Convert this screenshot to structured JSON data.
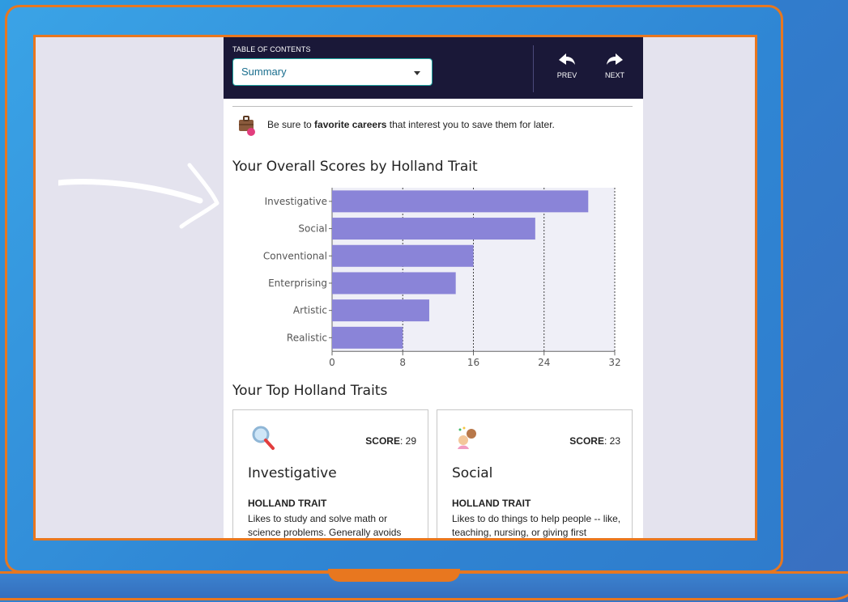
{
  "toc": {
    "label": "TABLE OF CONTENTS",
    "selected": "Summary"
  },
  "nav": {
    "prev_label": "PREV",
    "next_label": "NEXT"
  },
  "tip": {
    "prefix": "Be sure to ",
    "bold": "favorite careers",
    "suffix": " that interest you to save them for later."
  },
  "sections": {
    "overall_heading": "Your Overall Scores by Holland Trait",
    "top_heading": "Your Top Holland Traits"
  },
  "chart_data": {
    "type": "bar",
    "orientation": "horizontal",
    "title": "Your Overall Scores by Holland Trait",
    "categories": [
      "Investigative",
      "Social",
      "Conventional",
      "Enterprising",
      "Artistic",
      "Realistic"
    ],
    "values": [
      29,
      23,
      16,
      14,
      11,
      8
    ],
    "xlim": [
      0,
      32
    ],
    "xticks": [
      "0",
      "8",
      "16",
      "24",
      "32"
    ],
    "grid": true,
    "bar_color": "#8a84d8"
  },
  "cards": [
    {
      "score_label": "SCORE",
      "score": ": 29",
      "title": "Investigative",
      "subtitle": "HOLLAND TRAIT",
      "description": "Likes to study and solve math or science problems. Generally avoids",
      "icon": "magnifier-icon"
    },
    {
      "score_label": "SCORE",
      "score": ": 23",
      "title": "Social",
      "subtitle": "HOLLAND TRAIT",
      "description": "Likes to do things to help people -- like, teaching, nursing, or giving first",
      "icon": "people-icon"
    }
  ],
  "colors": {
    "accent_orange": "#e8771f",
    "nav_bg": "#1a1838",
    "select_border": "#1fa3a0",
    "bar": "#8a84d8"
  }
}
